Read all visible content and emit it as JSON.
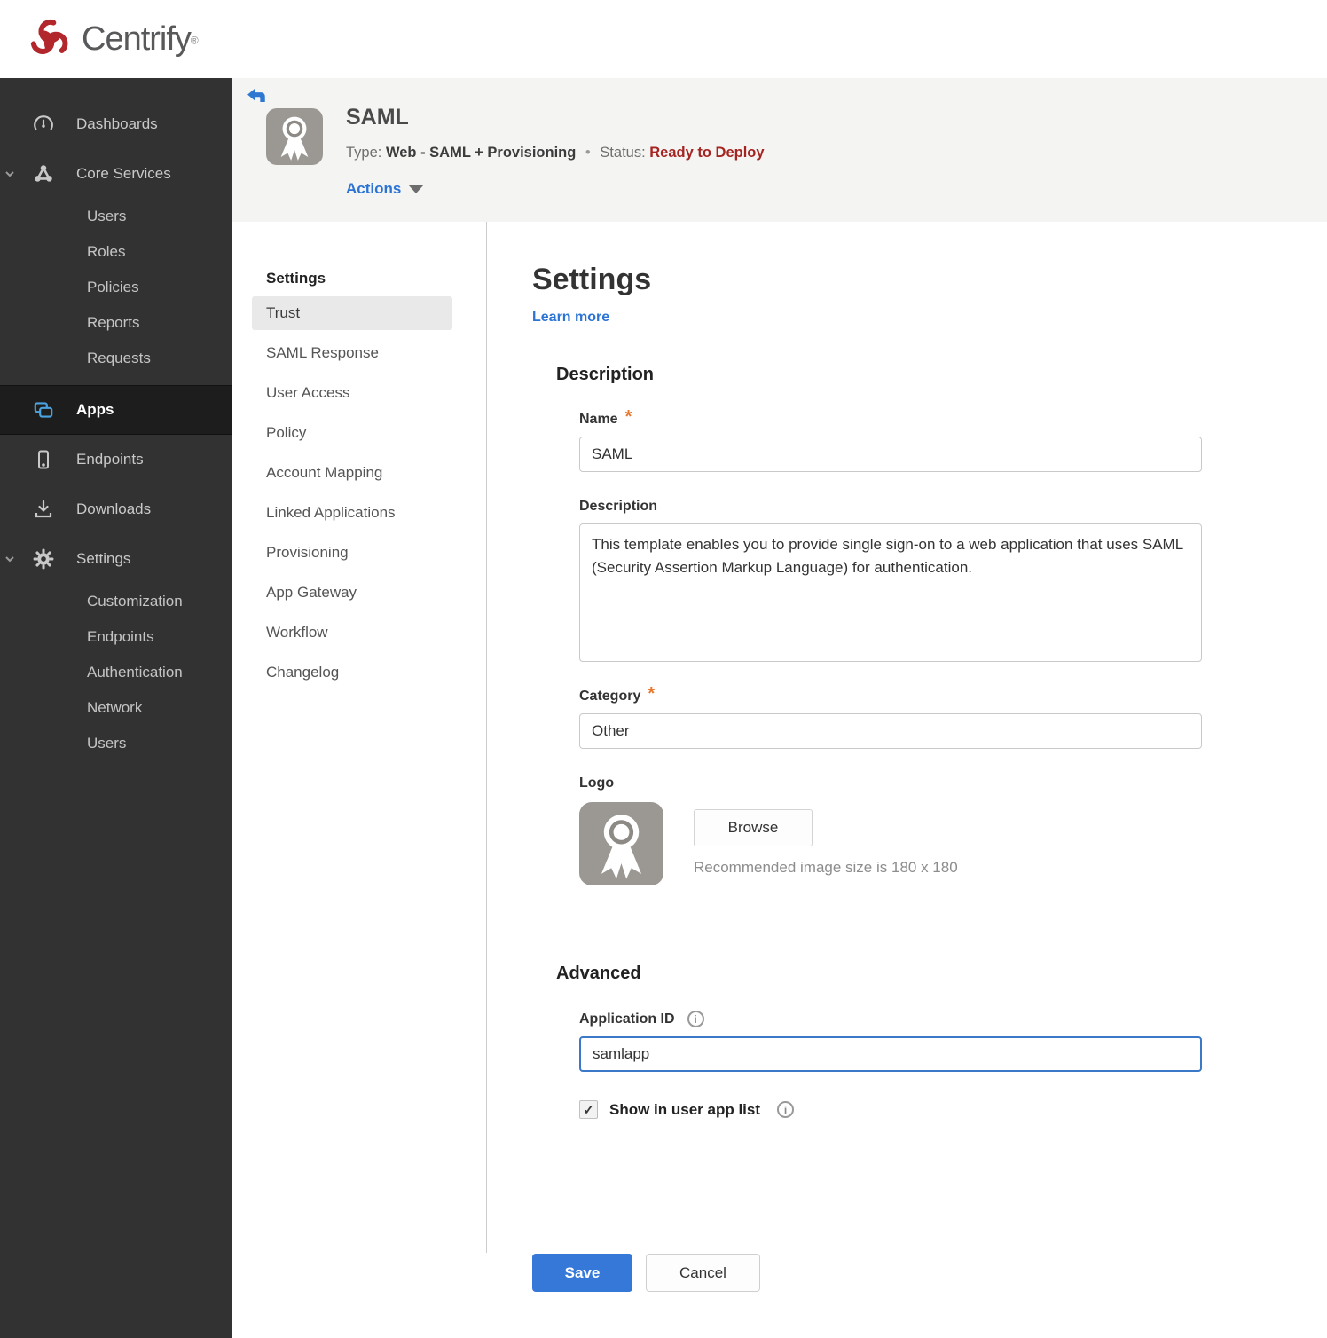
{
  "brand": {
    "name": "Centrify",
    "trademark": "®",
    "logo_color": "#b1272b"
  },
  "sidebar": {
    "items": [
      {
        "label": "Dashboards",
        "icon": "gauge-icon"
      },
      {
        "label": "Core Services",
        "icon": "core-services-icon",
        "expanded": true,
        "children": [
          "Users",
          "Roles",
          "Policies",
          "Reports",
          "Requests"
        ]
      },
      {
        "label": "Apps",
        "icon": "apps-icon",
        "active": true
      },
      {
        "label": "Endpoints",
        "icon": "mobile-icon"
      },
      {
        "label": "Downloads",
        "icon": "download-icon"
      },
      {
        "label": "Settings",
        "icon": "gear-icon",
        "expanded": true,
        "children": [
          "Customization",
          "Endpoints",
          "Authentication",
          "Network",
          "Users"
        ]
      }
    ]
  },
  "header": {
    "title": "SAML",
    "type_label": "Type:",
    "type_value": "Web - SAML + Provisioning",
    "separator": "•",
    "status_label": "Status:",
    "status_value": "Ready to Deploy",
    "actions_label": "Actions"
  },
  "subnav": {
    "heading": "Settings",
    "active_item": "Trust",
    "items": [
      "Trust",
      "SAML Response",
      "User Access",
      "Policy",
      "Account Mapping",
      "Linked Applications",
      "Provisioning",
      "App Gateway",
      "Workflow",
      "Changelog"
    ]
  },
  "main": {
    "title": "Settings",
    "learn_more_label": "Learn more",
    "required_marker": "*",
    "description_section": {
      "heading": "Description",
      "name_label": "Name",
      "name_value": "SAML",
      "description_label": "Description",
      "description_value": "This template enables you to provide single sign-on to a web application that uses SAML (Security Assertion Markup Language) for authentication.",
      "category_label": "Category",
      "category_value": "Other",
      "logo_label": "Logo",
      "browse_label": "Browse",
      "logo_hint": "Recommended image size is 180 x 180"
    },
    "advanced_section": {
      "heading": "Advanced",
      "application_id_label": "Application ID",
      "application_id_value": "samlapp",
      "show_in_app_list_label": "Show in user app list",
      "show_in_app_list_checked": true
    },
    "save_label": "Save",
    "cancel_label": "Cancel"
  },
  "colors": {
    "accent_blue": "#2c74d4",
    "status_red": "#a42422",
    "required_orange": "#e8782e",
    "sidebar_bg": "#323232",
    "sidebar_active_bg": "#1d1d1d",
    "focused_input_border": "#3c78c8"
  }
}
